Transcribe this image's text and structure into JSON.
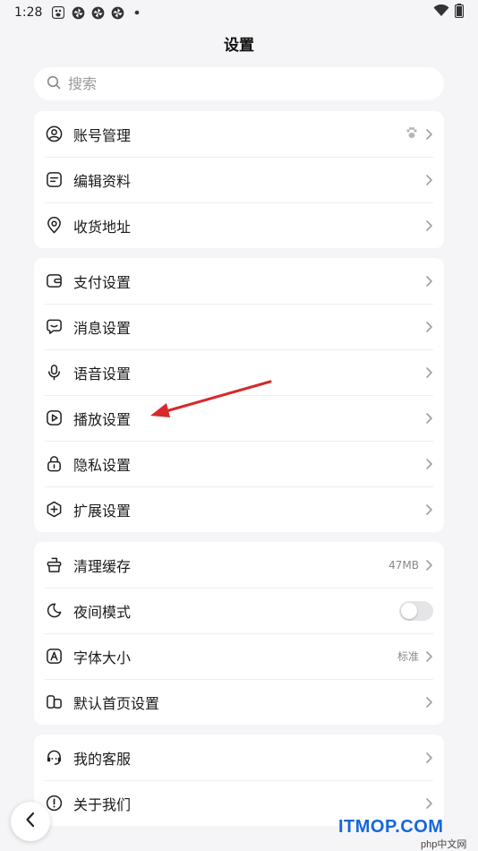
{
  "status_bar": {
    "time": "1:28",
    "icons": [
      "baidu-paw-icon",
      "pinwheel-icon",
      "pinwheel-icon",
      "pinwheel-icon",
      "dot-icon"
    ],
    "right_icons": [
      "wifi-icon",
      "battery-icon"
    ]
  },
  "header": {
    "title": "设置"
  },
  "search": {
    "placeholder": "搜索",
    "value": ""
  },
  "groups": [
    {
      "items": [
        {
          "label": "账号管理",
          "icon": "user-circle-icon",
          "trailing": "paw-icon"
        },
        {
          "label": "编辑资料",
          "icon": "edit-note-icon"
        },
        {
          "label": "收货地址",
          "icon": "location-pin-icon"
        }
      ]
    },
    {
      "items": [
        {
          "label": "支付设置",
          "icon": "wallet-icon"
        },
        {
          "label": "消息设置",
          "icon": "message-icon"
        },
        {
          "label": "语音设置",
          "icon": "microphone-icon"
        },
        {
          "label": "播放设置",
          "icon": "play-icon"
        },
        {
          "label": "隐私设置",
          "icon": "lock-icon"
        },
        {
          "label": "扩展设置",
          "icon": "plus-hexagon-icon"
        }
      ]
    },
    {
      "items": [
        {
          "label": "清理缓存",
          "icon": "broom-icon",
          "value": "47MB"
        },
        {
          "label": "夜间模式",
          "icon": "moon-icon",
          "toggle": false
        },
        {
          "label": "字体大小",
          "icon": "font-size-icon",
          "value": "标准"
        },
        {
          "label": "默认首页设置",
          "icon": "home-layout-icon"
        }
      ]
    },
    {
      "items": [
        {
          "label": "我的客服",
          "icon": "headset-icon"
        },
        {
          "label": "关于我们",
          "icon": "info-circle-icon"
        }
      ]
    }
  ],
  "annotation": {
    "color": "#d62a2a"
  },
  "watermark": {
    "text": "ITMOP.COM",
    "sub": "php中文网"
  },
  "colors": {
    "background": "#f5f5f7",
    "card": "#ffffff",
    "watermark": "#1667d9"
  }
}
